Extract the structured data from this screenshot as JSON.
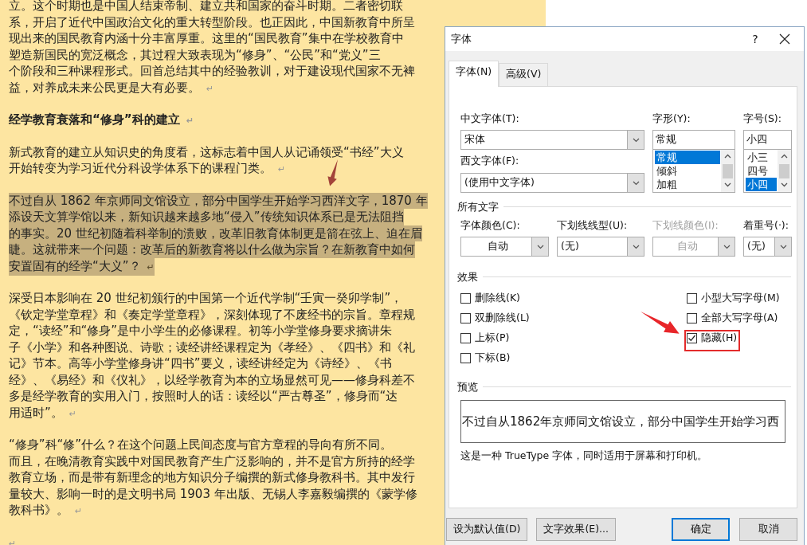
{
  "document": {
    "paragraphs": [
      {
        "kind": "body",
        "selected": false,
        "lines": [
          "立。这个时期也是中国人结束帝制、建立共和国家的奋斗时期。二者密切联",
          "系，开启了近代中国政治文化的重大转型阶段。也正因此，中国新教育中所呈",
          "现出来的国民教育内涵十分丰富厚重。这里的“国民教育”集中在学校教育中",
          "塑造新国民的宽泛概念，其过程大致表现为“修身”、“公民”和“党义”三",
          "个阶段和三种课程形式。回首总结其中的经验教训，对于建设现代国家不无裨",
          "益，对养成未来公民更是大有必要。"
        ],
        "end_mark": "↵"
      },
      {
        "kind": "heading",
        "selected": false,
        "lines": [
          "经学教育衰落和“修身”科的建立"
        ],
        "end_mark": "↵"
      },
      {
        "kind": "body",
        "selected": false,
        "lines": [
          "新式教育的建立从知识史的角度看，这标志着中国人从记诵领受“书经”大义",
          "开始转变为学习近代分科设学体系下的课程门类。"
        ],
        "end_mark": "↵"
      },
      {
        "kind": "body",
        "selected": true,
        "lines": [
          "不过自从 1862 年京师同文馆设立，部分中国学生开始学习西洋文字，1870 年",
          "添设天文算学馆以来，新知识越来越多地“侵入”传统知识体系已是无法阻挡",
          "的事实。20 世纪初随着科举制的溃败，改革旧教育体制更是箭在弦上、迫在眉",
          "睫。这就带来一个问题：改革后的新教育将以什么做为宗旨？在新教育中如何",
          "安置固有的经学“大义”？"
        ],
        "end_mark": "↵"
      },
      {
        "kind": "body",
        "selected": false,
        "lines": [
          "深受日本影响在 20 世纪初颁行的中国第一个近代学制“壬寅一癸卯学制”，",
          "《钦定学堂章程》和《奏定学堂章程》，深刻体现了不废经书的宗旨。章程规",
          "定，“读经”和“修身”是中小学生的必修课程。初等小学堂修身要求摘讲朱",
          "子《小学》和各种图说、诗歌；读经讲经课程定为《孝经》、《四书》和《礼",
          "记》节本。高等小学堂修身讲“四书”要义，读经讲经定为《诗经》、《书",
          "经》、《易经》和《仪礼》，以经学教育为本的立场显然可见——修身科差不",
          "多是经学教育的实用入门，按照时人的话：读经以“严古尊圣”，修身而“达",
          "用适时”。"
        ],
        "end_mark": "↵"
      },
      {
        "kind": "body",
        "selected": false,
        "lines": [
          "“修身”科“修”什么？在这个问题上民间态度与官方章程的导向有所不同。",
          "而且，在晚清教育实践中对国民教育产生广泛影响的，并不是官方所持的经学",
          "教育立场，而是带有新理念的地方知识分子编撰的新式修身教科书。其中发行",
          "量较大、影响一时的是文明书局 1903 年出版、无锡人李嘉毅编撰的《蒙学修",
          "教科书》。"
        ],
        "end_mark": "↵"
      },
      {
        "kind": "empty",
        "selected": false,
        "end_mark": "↵"
      }
    ]
  },
  "dialog": {
    "title": "字体",
    "help": "?",
    "tabs": [
      {
        "label": "字体(N)",
        "selected": true
      },
      {
        "label": "高级(V)",
        "selected": false
      }
    ],
    "chinese_font": {
      "label": "中文字体(T):",
      "value": "宋体"
    },
    "western_font": {
      "label": "西文字体(F):",
      "value": "(使用中文字体)"
    },
    "style": {
      "label": "字形(Y):",
      "value": "常规",
      "items": [
        {
          "label": "常规",
          "selected": true
        },
        {
          "label": "倾斜",
          "selected": false
        },
        {
          "label": "加粗",
          "selected": false
        }
      ]
    },
    "size": {
      "label": "字号(S):",
      "value": "小四",
      "items": [
        {
          "label": "小三",
          "selected": false
        },
        {
          "label": "四号",
          "selected": false
        },
        {
          "label": "小四",
          "selected": true
        }
      ]
    },
    "all_text": {
      "title": "所有文字",
      "fields": [
        {
          "kind": "color",
          "label": "字体颜色(C):",
          "value": "自动",
          "disabled": false
        },
        {
          "kind": "list",
          "label": "下划线线型(U):",
          "value": "(无)",
          "disabled": false
        },
        {
          "kind": "color",
          "label": "下划线颜色(I):",
          "value": "自动",
          "disabled": true
        },
        {
          "kind": "list",
          "label": "着重号(·):",
          "value": "(无)",
          "disabled": false
        }
      ]
    },
    "effects": {
      "title": "效果",
      "left": [
        {
          "label": "删除线(K)",
          "checked": false
        },
        {
          "label": "双删除线(L)",
          "checked": false
        },
        {
          "label": "上标(P)",
          "checked": false
        },
        {
          "label": "下标(B)",
          "checked": false
        }
      ],
      "right": [
        {
          "label": "小型大写字母(M)",
          "checked": false
        },
        {
          "label": "全部大写字母(A)",
          "checked": false
        },
        {
          "label": "隐藏(H)",
          "checked": true
        }
      ]
    },
    "preview": {
      "title": "预览",
      "text": "不过自从1862年京师同文馆设立，部分中国学生开始学习西",
      "note": "这是一种 TrueType 字体，同时适用于屏幕和打印机。"
    },
    "buttons_left": [
      {
        "label": "设为默认值(D)",
        "default": false
      },
      {
        "label": "文字效果(E)...",
        "default": false
      }
    ],
    "buttons_right": [
      {
        "label": "确定",
        "default": true
      },
      {
        "label": "取消",
        "default": false
      }
    ]
  }
}
